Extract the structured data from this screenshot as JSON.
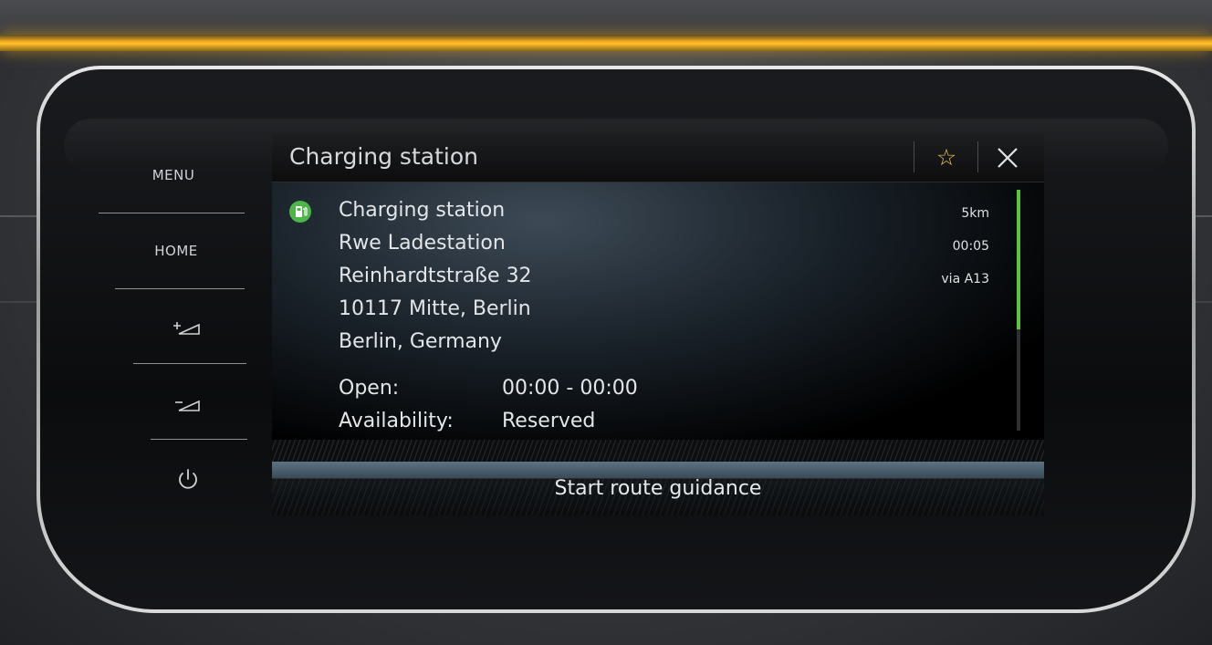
{
  "side_menu": {
    "menu_label": "MENU",
    "home_label": "HOME",
    "volume_up_icon": "volume-up-icon",
    "volume_down_icon": "volume-down-icon",
    "power_icon": "power-icon"
  },
  "header": {
    "title": "Charging station",
    "favorite_icon": "star-icon",
    "close_icon": "close-icon",
    "accent_color": "#e6c34a"
  },
  "details": {
    "poi_icon": "charging-station-icon",
    "poi_color": "#4cb648",
    "lines": [
      "Charging station",
      "Rwe Ladestation",
      "Reinhardtstraße 32",
      "10117 Mitte, Berlin",
      "Berlin, Germany"
    ],
    "distance": "5km",
    "eta": "00:05",
    "via": "via A13",
    "open_label": "Open:",
    "open_value": "00:00 - 00:00",
    "availability_label": "Availability:",
    "availability_value": "Reserved"
  },
  "scroll": {
    "position_fraction": 0.58,
    "color": "#5fc43c"
  },
  "actions": {
    "start_route_label": "Start route guidance"
  }
}
